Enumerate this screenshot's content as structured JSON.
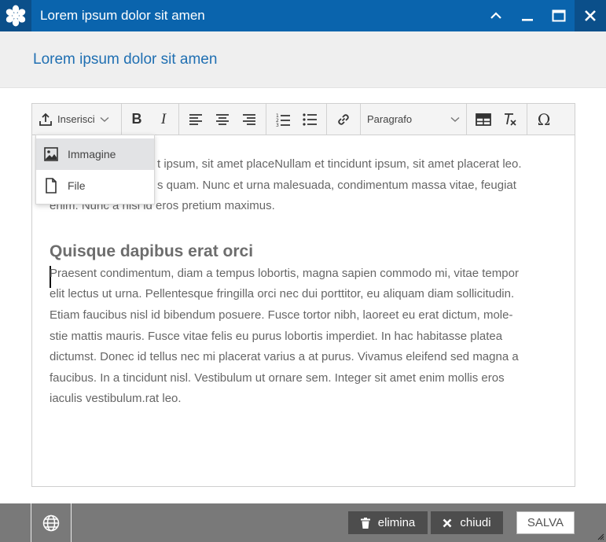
{
  "window": {
    "title": "Lorem ipsum dolor sit amen",
    "icons": [
      "asterisk-logo-icon",
      "collapse-icon",
      "minimize-icon",
      "maximize-icon",
      "close-icon"
    ]
  },
  "header": {
    "title": "Lorem ipsum dolor sit amen"
  },
  "toolbar": {
    "insert_label": "Inserisci",
    "paragraph_label": "Paragrafo",
    "bold_label": "B",
    "italic_label": "I",
    "special_char_label": "Ω"
  },
  "insert_menu": {
    "items": [
      {
        "label": "Immagine",
        "icon": "image-icon",
        "active": true
      },
      {
        "label": "File",
        "icon": "file-icon",
        "active": false
      }
    ]
  },
  "content": {
    "intro_visible": [
      "t ipsum, sit amet placeNullam et tincidunt ipsum, sit amet placerat leo.",
      "s quam. Nunc et urna malesuada, condimentum massa vitae, feugiat",
      "enim. Nunc a nisi id eros pretium maximus."
    ],
    "heading": "Quisque dapibus erat orci",
    "body_lines": [
      "Praesent condimentum, diam a tempus lobortis, magna sapien commodo mi, vitae tempor",
      "elit lectus ut urna. Pellentesque fringilla orci nec dui porttitor, eu aliquam diam sollicitudin.",
      "Etiam faucibus nisl id bibendum posuere. Fusce tortor nibh, laoreet eu erat dictum, mole-",
      "stie mattis mauris. Fusce vitae felis eu purus lobortis imperdiet. In hac habitasse platea",
      "dictumst. Donec id tellus nec mi placerat varius a at purus. Vivamus eleifend sed magna a",
      "faucibus. In a tincidunt nisl. Vestibulum ut ornare sem. Integer sit amet enim mollis eros",
      "iaculis vestibulum.rat leo."
    ]
  },
  "footer": {
    "delete_label": "elimina",
    "close_label": "chiudi",
    "save_label": "SALVA"
  },
  "colors": {
    "titlebar": "#0a64ad",
    "titlebar_dark": "#0b4f8a",
    "header_text": "#1f6fb2",
    "footer_bg": "#797979",
    "footer_button": "#4d4d4d"
  }
}
